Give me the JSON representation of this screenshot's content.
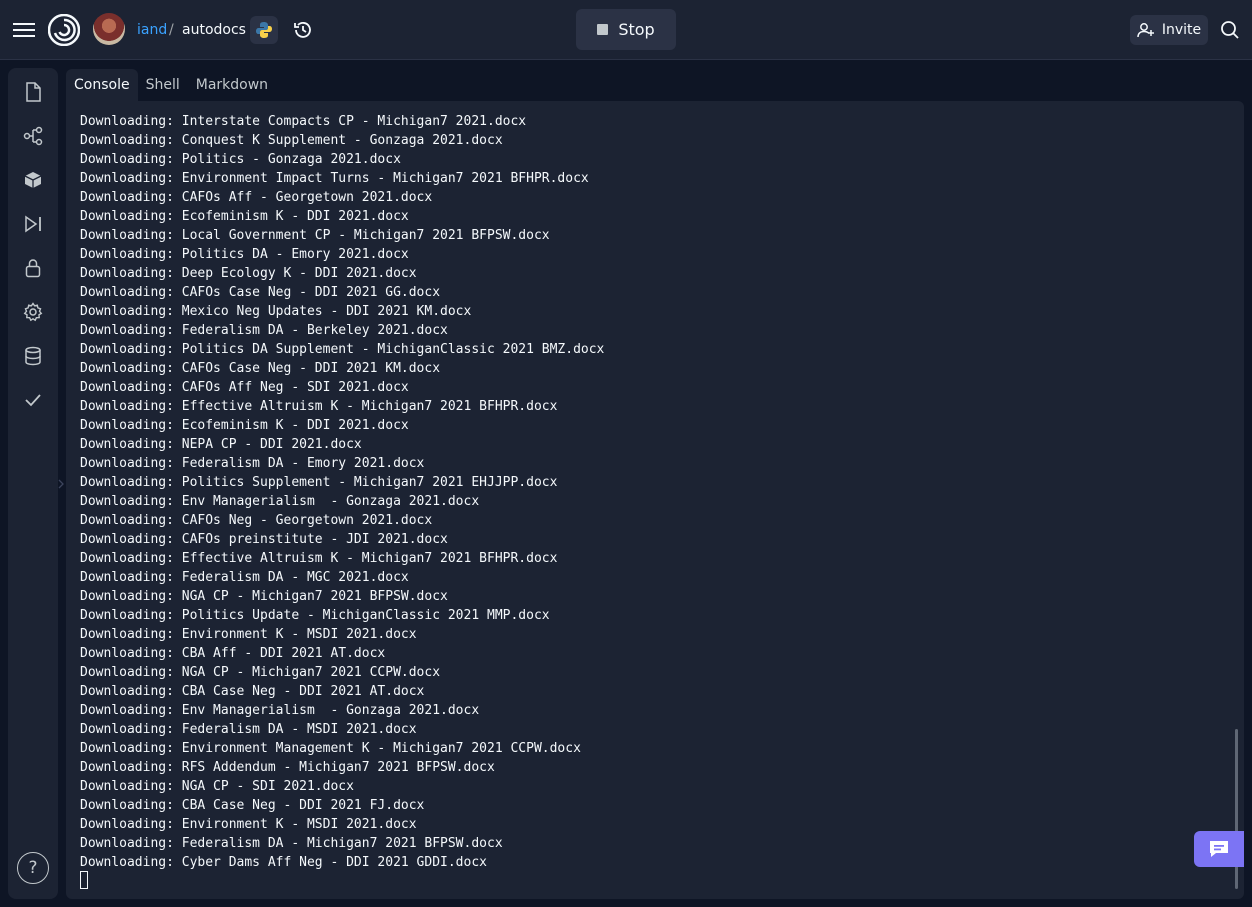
{
  "header": {
    "owner": "iand",
    "separator": "/",
    "repl_name": "autodocs",
    "stop_label": "Stop",
    "invite_label": "Invite",
    "icons": [
      "menu-icon",
      "replit-logo-icon",
      "python-icon",
      "history-icon",
      "invite-user-icon",
      "search-icon"
    ]
  },
  "sidebar": {
    "items": [
      {
        "name": "files-icon"
      },
      {
        "name": "version-control-icon"
      },
      {
        "name": "packages-icon"
      },
      {
        "name": "debugger-icon"
      },
      {
        "name": "secrets-icon"
      },
      {
        "name": "settings-icon"
      },
      {
        "name": "database-icon"
      },
      {
        "name": "tests-icon"
      }
    ],
    "help_label": "?"
  },
  "tabs": [
    {
      "label": "Console",
      "active": true
    },
    {
      "label": "Shell",
      "active": false
    },
    {
      "label": "Markdown",
      "active": false
    }
  ],
  "console": {
    "lines": [
      "Downloading: Interstate Compacts CP - Michigan7 2021.docx",
      "Downloading: Conquest K Supplement - Gonzaga 2021.docx",
      "Downloading: Politics - Gonzaga 2021.docx",
      "Downloading: Environment Impact Turns - Michigan7 2021 BFHPR.docx",
      "Downloading: CAFOs Aff - Georgetown 2021.docx",
      "Downloading: Ecofeminism K - DDI 2021.docx",
      "Downloading: Local Government CP - Michigan7 2021 BFPSW.docx",
      "Downloading: Politics DA - Emory 2021.docx",
      "Downloading: Deep Ecology K - DDI 2021.docx",
      "Downloading: CAFOs Case Neg - DDI 2021 GG.docx",
      "Downloading: Mexico Neg Updates - DDI 2021 KM.docx",
      "Downloading: Federalism DA - Berkeley 2021.docx",
      "Downloading: Politics DA Supplement - MichiganClassic 2021 BMZ.docx",
      "Downloading: CAFOs Case Neg - DDI 2021 KM.docx",
      "Downloading: CAFOs Aff Neg - SDI 2021.docx",
      "Downloading: Effective Altruism K - Michigan7 2021 BFHPR.docx",
      "Downloading: Ecofeminism K - DDI 2021.docx",
      "Downloading: NEPA CP - DDI 2021.docx",
      "Downloading: Federalism DA - Emory 2021.docx",
      "Downloading: Politics Supplement - Michigan7 2021 EHJJPP.docx",
      "Downloading: Env Managerialism  - Gonzaga 2021.docx",
      "Downloading: CAFOs Neg - Georgetown 2021.docx",
      "Downloading: CAFOs preinstitute - JDI 2021.docx",
      "Downloading: Effective Altruism K - Michigan7 2021 BFHPR.docx",
      "Downloading: Federalism DA - MGC 2021.docx",
      "Downloading: NGA CP - Michigan7 2021 BFPSW.docx",
      "Downloading: Politics Update - MichiganClassic 2021 MMP.docx",
      "Downloading: Environment K - MSDI 2021.docx",
      "Downloading: CBA Aff - DDI 2021 AT.docx",
      "Downloading: NGA CP - Michigan7 2021 CCPW.docx",
      "Downloading: CBA Case Neg - DDI 2021 AT.docx",
      "Downloading: Env Managerialism  - Gonzaga 2021.docx",
      "Downloading: Federalism DA - MSDI 2021.docx",
      "Downloading: Environment Management K - Michigan7 2021 CCPW.docx",
      "Downloading: RFS Addendum - Michigan7 2021 BFPSW.docx",
      "Downloading: NGA CP - SDI 2021.docx",
      "Downloading: CBA Case Neg - DDI 2021 FJ.docx",
      "Downloading: Environment K - MSDI 2021.docx",
      "Downloading: Federalism DA - Michigan7 2021 BFPSW.docx",
      "Downloading: Cyber Dams Aff Neg - DDI 2021 GDDI.docx"
    ]
  },
  "colors": {
    "background": "#0e1525",
    "panel": "#1c2333",
    "accent_link": "#3aa2ff",
    "chat_button": "#7c74f4"
  }
}
